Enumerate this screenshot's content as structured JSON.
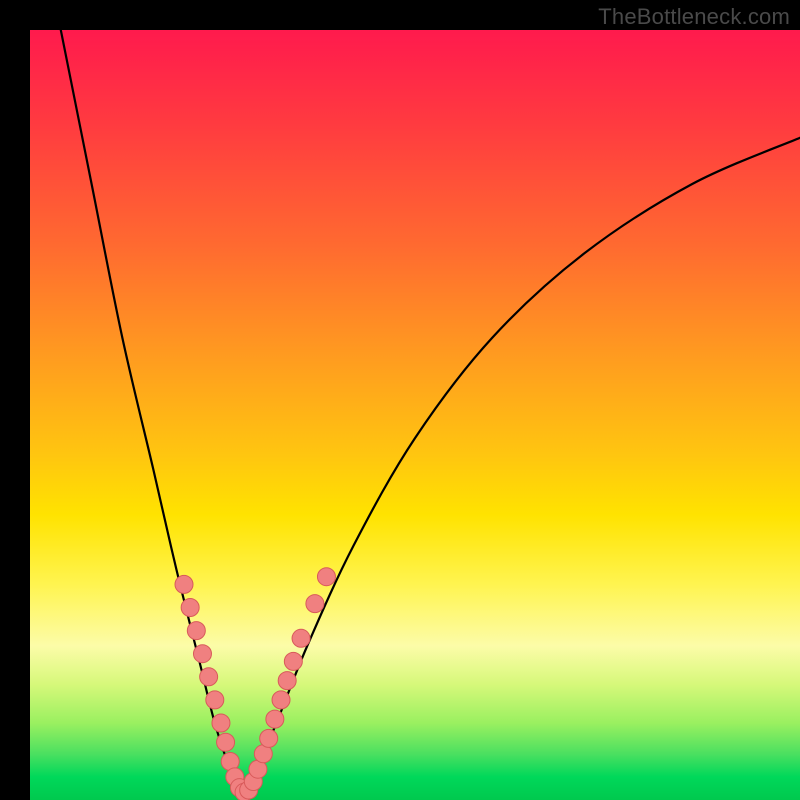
{
  "watermark": "TheBottleneck.com",
  "colors": {
    "frame_bg": "#000000",
    "curve_stroke": "#000000",
    "dot_fill": "#f08080",
    "dot_stroke": "#d85a5a"
  },
  "chart_data": {
    "type": "line",
    "title": "",
    "xlabel": "",
    "ylabel": "",
    "xlim": [
      0,
      100
    ],
    "ylim": [
      0,
      100
    ],
    "note": "Image shows no numeric axes; values are approximate in 0–100 percent units (x right, y up).",
    "series": [
      {
        "name": "bottleneck-curve",
        "x": [
          4,
          8,
          12,
          16,
          19,
          22,
          24,
          26,
          27.5,
          29,
          32,
          36,
          42,
          50,
          60,
          72,
          86,
          100
        ],
        "y": [
          100,
          80,
          60,
          43,
          30,
          18,
          10,
          4,
          1,
          3,
          10,
          20,
          33,
          47,
          60,
          71,
          80,
          86
        ]
      }
    ],
    "dots": {
      "name": "highlight-dots",
      "points": [
        {
          "x": 20.0,
          "y": 28.0
        },
        {
          "x": 20.8,
          "y": 25.0
        },
        {
          "x": 21.6,
          "y": 22.0
        },
        {
          "x": 22.4,
          "y": 19.0
        },
        {
          "x": 23.2,
          "y": 16.0
        },
        {
          "x": 24.0,
          "y": 13.0
        },
        {
          "x": 24.8,
          "y": 10.0
        },
        {
          "x": 25.4,
          "y": 7.5
        },
        {
          "x": 26.0,
          "y": 5.0
        },
        {
          "x": 26.6,
          "y": 3.0
        },
        {
          "x": 27.2,
          "y": 1.6
        },
        {
          "x": 27.8,
          "y": 1.0
        },
        {
          "x": 28.4,
          "y": 1.3
        },
        {
          "x": 29.0,
          "y": 2.4
        },
        {
          "x": 29.6,
          "y": 4.0
        },
        {
          "x": 30.3,
          "y": 6.0
        },
        {
          "x": 31.0,
          "y": 8.0
        },
        {
          "x": 31.8,
          "y": 10.5
        },
        {
          "x": 32.6,
          "y": 13.0
        },
        {
          "x": 33.4,
          "y": 15.5
        },
        {
          "x": 34.2,
          "y": 18.0
        },
        {
          "x": 35.2,
          "y": 21.0
        },
        {
          "x": 37.0,
          "y": 25.5
        },
        {
          "x": 38.5,
          "y": 29.0
        }
      ]
    }
  }
}
